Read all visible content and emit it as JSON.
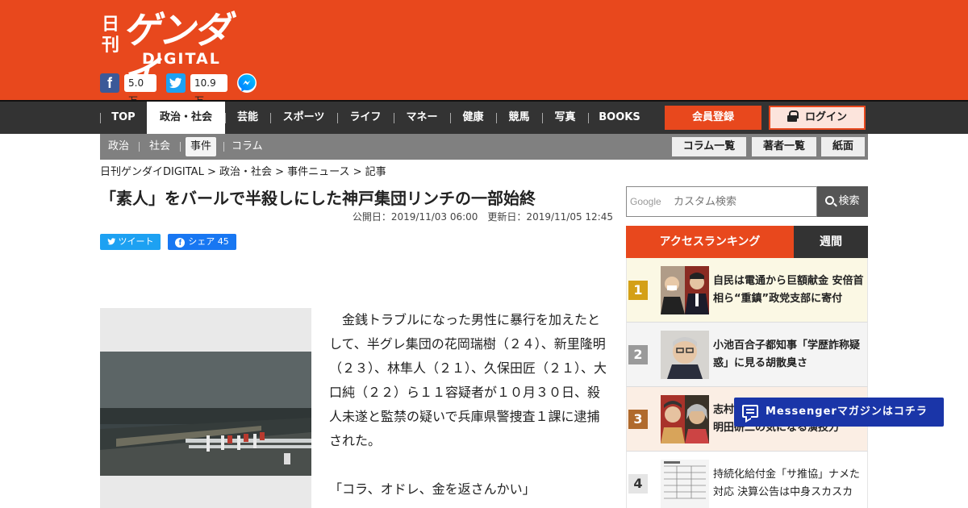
{
  "brand": {
    "nikkan": "日刊",
    "gendai": "ゲンダイ",
    "digital": "DIGITAL"
  },
  "header_share": {
    "facebook_count": "5.0万",
    "twitter_count": "10.9万"
  },
  "nav": {
    "items": [
      "TOP",
      "政治・社会",
      "芸能",
      "スポーツ",
      "ライフ",
      "マネー",
      "健康",
      "競馬",
      "写真",
      "BOOKS"
    ],
    "active": "政治・社会",
    "register_label": "会員登録",
    "login_label": "ログイン"
  },
  "subnav": {
    "items": [
      "政治",
      "社会",
      "事件",
      "コラム"
    ],
    "active": "事件",
    "buttons": [
      "コラム一覧",
      "著者一覧",
      "紙面"
    ]
  },
  "breadcrumb": "日刊ゲンダイDIGITAL > 政治・社会 > 事件ニュース > 記事",
  "article": {
    "title": "「素人」をバールで半殺しにした神戸集団リンチの一部始終",
    "published": "公開日：2019/11/03 06:00　更新日：2019/11/05 12:45",
    "tweet_label": "ツイート",
    "fb_share_label": "シェア 45",
    "paragraph1": "金銭トラブルになった男性に暴行を加えたとして、半グレ集団の花岡瑞樹（２４）、新里隆明（２３）、林隼人（２１）、久保田匠（２１）、大口純（２２）ら１１容疑者が１０月３０日、殺人未遂と監禁の疑いで兵庫県警捜査１課に逮捕された。",
    "quote": "「コラ、オドレ、金を返さんかい」"
  },
  "search": {
    "google_label": "Google",
    "placeholder": "カスタム検索",
    "button_label": "検索"
  },
  "ranking": {
    "tab_access": "アクセスランキング",
    "tab_weekly": "週間",
    "items": [
      {
        "rank": "1",
        "text": "自民は電通から巨額献金 安倍首相ら“重鎮”政党支部に寄付",
        "color": "#d4a017",
        "bg": "#fbf8e4"
      },
      {
        "rank": "2",
        "text": "小池百合子都知事「学歴詐称疑惑」に見る胡散臭さ",
        "color": "#9a9a9a",
        "bg": "#f4f4f4"
      },
      {
        "rank": "3",
        "text": "志村けんさん最期の舞台・柄本明田研二の気になる演技力",
        "color": "#b06a2c",
        "bg": "#fbeee4"
      },
      {
        "rank": "4",
        "text": "持続化給付金「サ推協」ナメた対応 決算公告は中身スカスカ",
        "color": "#e5e5e5",
        "bg": "#ffffff"
      }
    ]
  },
  "messenger": {
    "label": "Messengerマガジンはコチラ"
  },
  "colors": {
    "brand_orange": "#e8481d",
    "nav_dark": "#333333",
    "subnav_gray": "#808080",
    "messenger_blue": "#1a35a8"
  }
}
